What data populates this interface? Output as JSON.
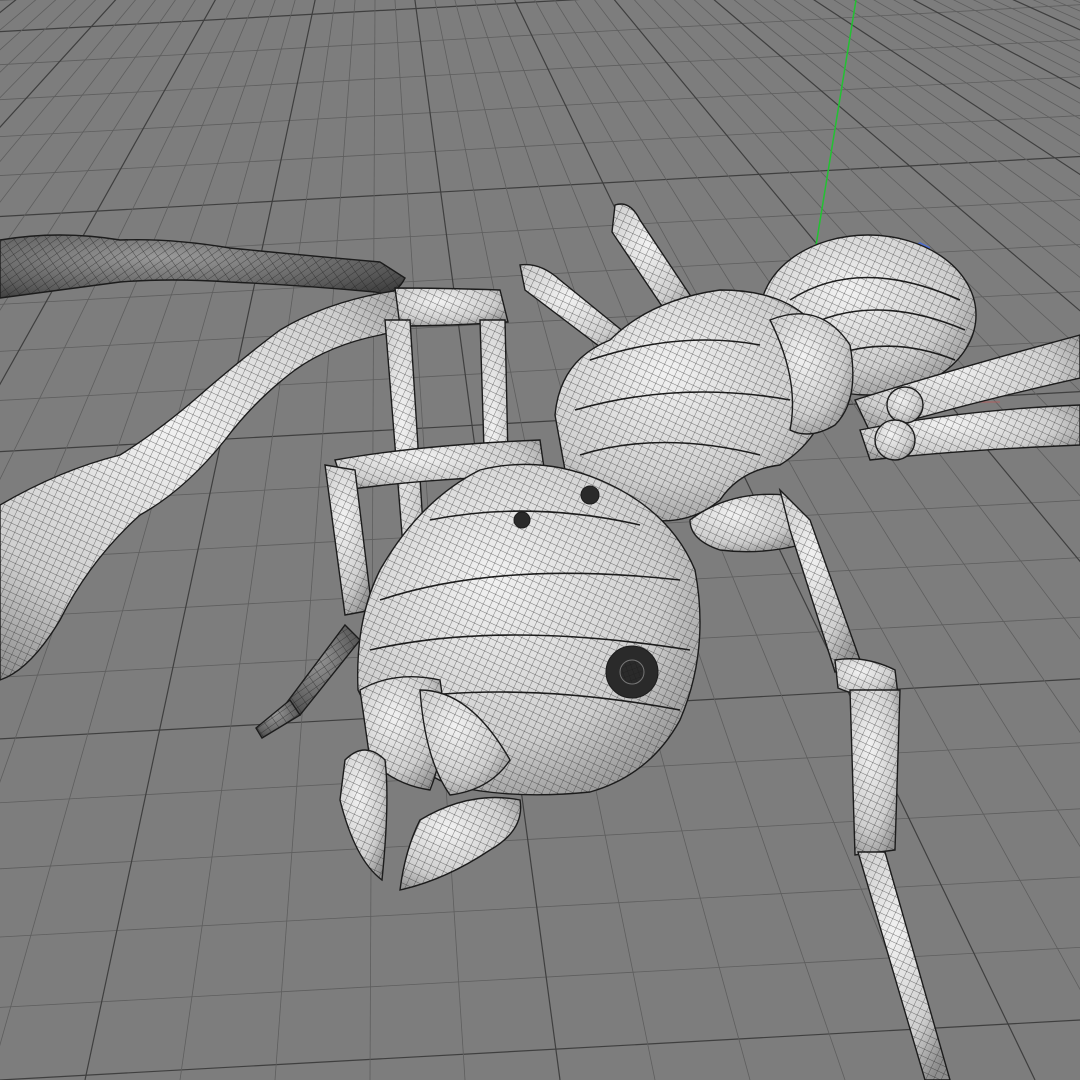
{
  "viewport": {
    "background": "#7d7d7d",
    "grid_line_color": "#5e5e5e",
    "grid_major_color": "#3f3f3f",
    "y_axis_color": "#22c232",
    "x_axis_color": "#c25a5a",
    "gizmo_color": "#4a6cd4"
  },
  "model": {
    "surface_fill": "#e6e6e6",
    "surface_shadow": "#9a9a9a",
    "wire_color": "#1c1c1c",
    "dark_fill": "#2a2a2a"
  }
}
